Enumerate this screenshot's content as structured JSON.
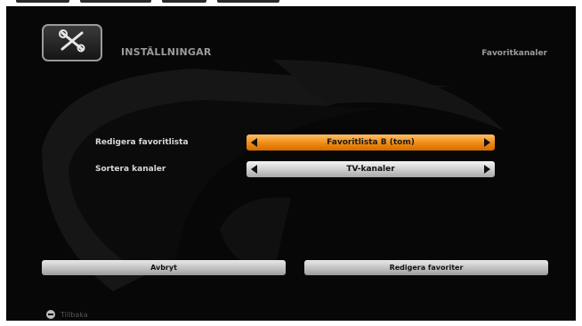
{
  "header": {
    "title": "INSTÄLLNINGAR",
    "context": "Favoritkanaler",
    "icon": "tools-icon"
  },
  "rows": [
    {
      "label": "Redigera favoritlista",
      "value": "Favoritlista B (tom)",
      "state": "focused"
    },
    {
      "label": "Sortera kanaler",
      "value": "TV-kanaler",
      "state": "normal"
    }
  ],
  "buttons": {
    "cancel": "Avbryt",
    "edit": "Redigera favoriter"
  },
  "footer": {
    "back_label": "Tillbaka"
  },
  "colors": {
    "background": "#070707",
    "focus_orange": "#f08a10",
    "button_grey": "#c8c8c8",
    "text_grey": "#9b9b9b"
  }
}
